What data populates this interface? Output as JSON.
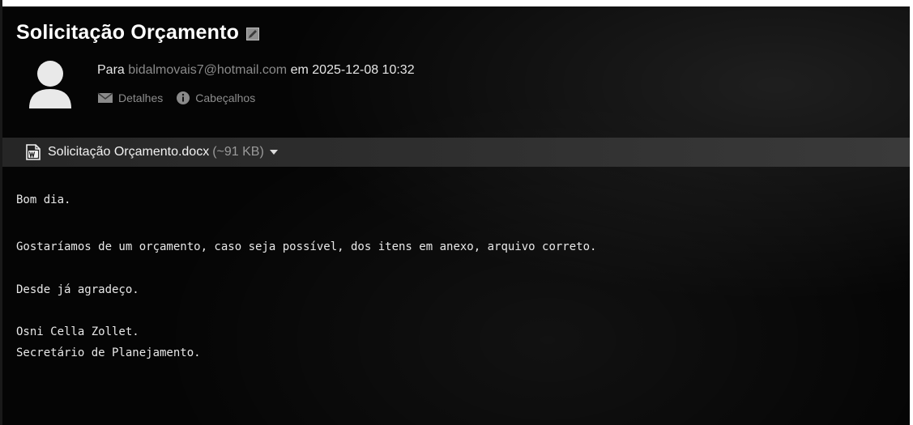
{
  "message": {
    "subject": "Solicitação Orçamento",
    "to_label": "Para",
    "to_address": "bidalmovais7@hotmail.com",
    "date_prefix": "em",
    "date": "2025-12-08 10:32",
    "links": {
      "details": "Detalhes",
      "headers": "Cabeçalhos"
    }
  },
  "attachment": {
    "name": "Solicitação Orçamento.docx",
    "size": "(~91 KB)"
  },
  "body": {
    "lines": [
      "Bom dia.",
      "Gostaríamos de um orçamento, caso seja possível, dos itens em anexo, arquivo correto.",
      "Desde já agradeço.",
      "Osni Cella Zollet.",
      "Secretário de Planejamento."
    ]
  },
  "colors": {
    "background": "#050505",
    "attachment_bar": "#2f2f2f",
    "text": "#e8e8e8",
    "muted": "#8c8c8c"
  }
}
